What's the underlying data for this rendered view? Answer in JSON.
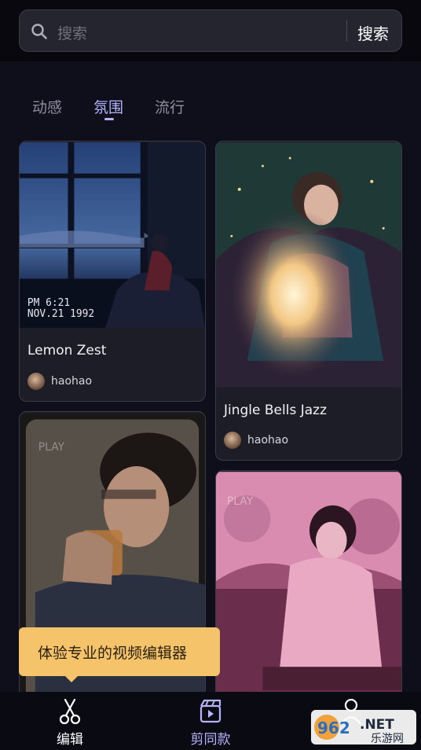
{
  "search": {
    "placeholder": "搜索",
    "button_label": "搜索"
  },
  "tabs": [
    {
      "label": "动感",
      "active": false
    },
    {
      "label": "氛围",
      "active": true
    },
    {
      "label": "流行",
      "active": false
    }
  ],
  "cards": [
    {
      "title": "Lemon Zest",
      "author": "haohao",
      "overlay_time": "PM  6:21",
      "overlay_date": "NOV.21  1992"
    },
    {
      "title": "Jingle Bells Jazz",
      "author": "haohao"
    },
    {
      "overlay_text": "PLAY"
    },
    {
      "overlay_text": "PLAY"
    }
  ],
  "tooltip": {
    "text": "体验专业的视频编辑器"
  },
  "bottom_nav": [
    {
      "label": "编辑",
      "icon": "scissors-icon",
      "active": true
    },
    {
      "label": "剪同款",
      "icon": "clapperboard-icon",
      "active": false
    },
    {
      "label": "",
      "icon": "user-icon",
      "active": false
    }
  ],
  "watermark": {
    "number": "962",
    "suffix": ".NET",
    "site": "乐游网"
  },
  "colors": {
    "accent": "#b8b3ff",
    "tooltip_bg": "#f5c46a",
    "background": "#0f0f1c"
  }
}
